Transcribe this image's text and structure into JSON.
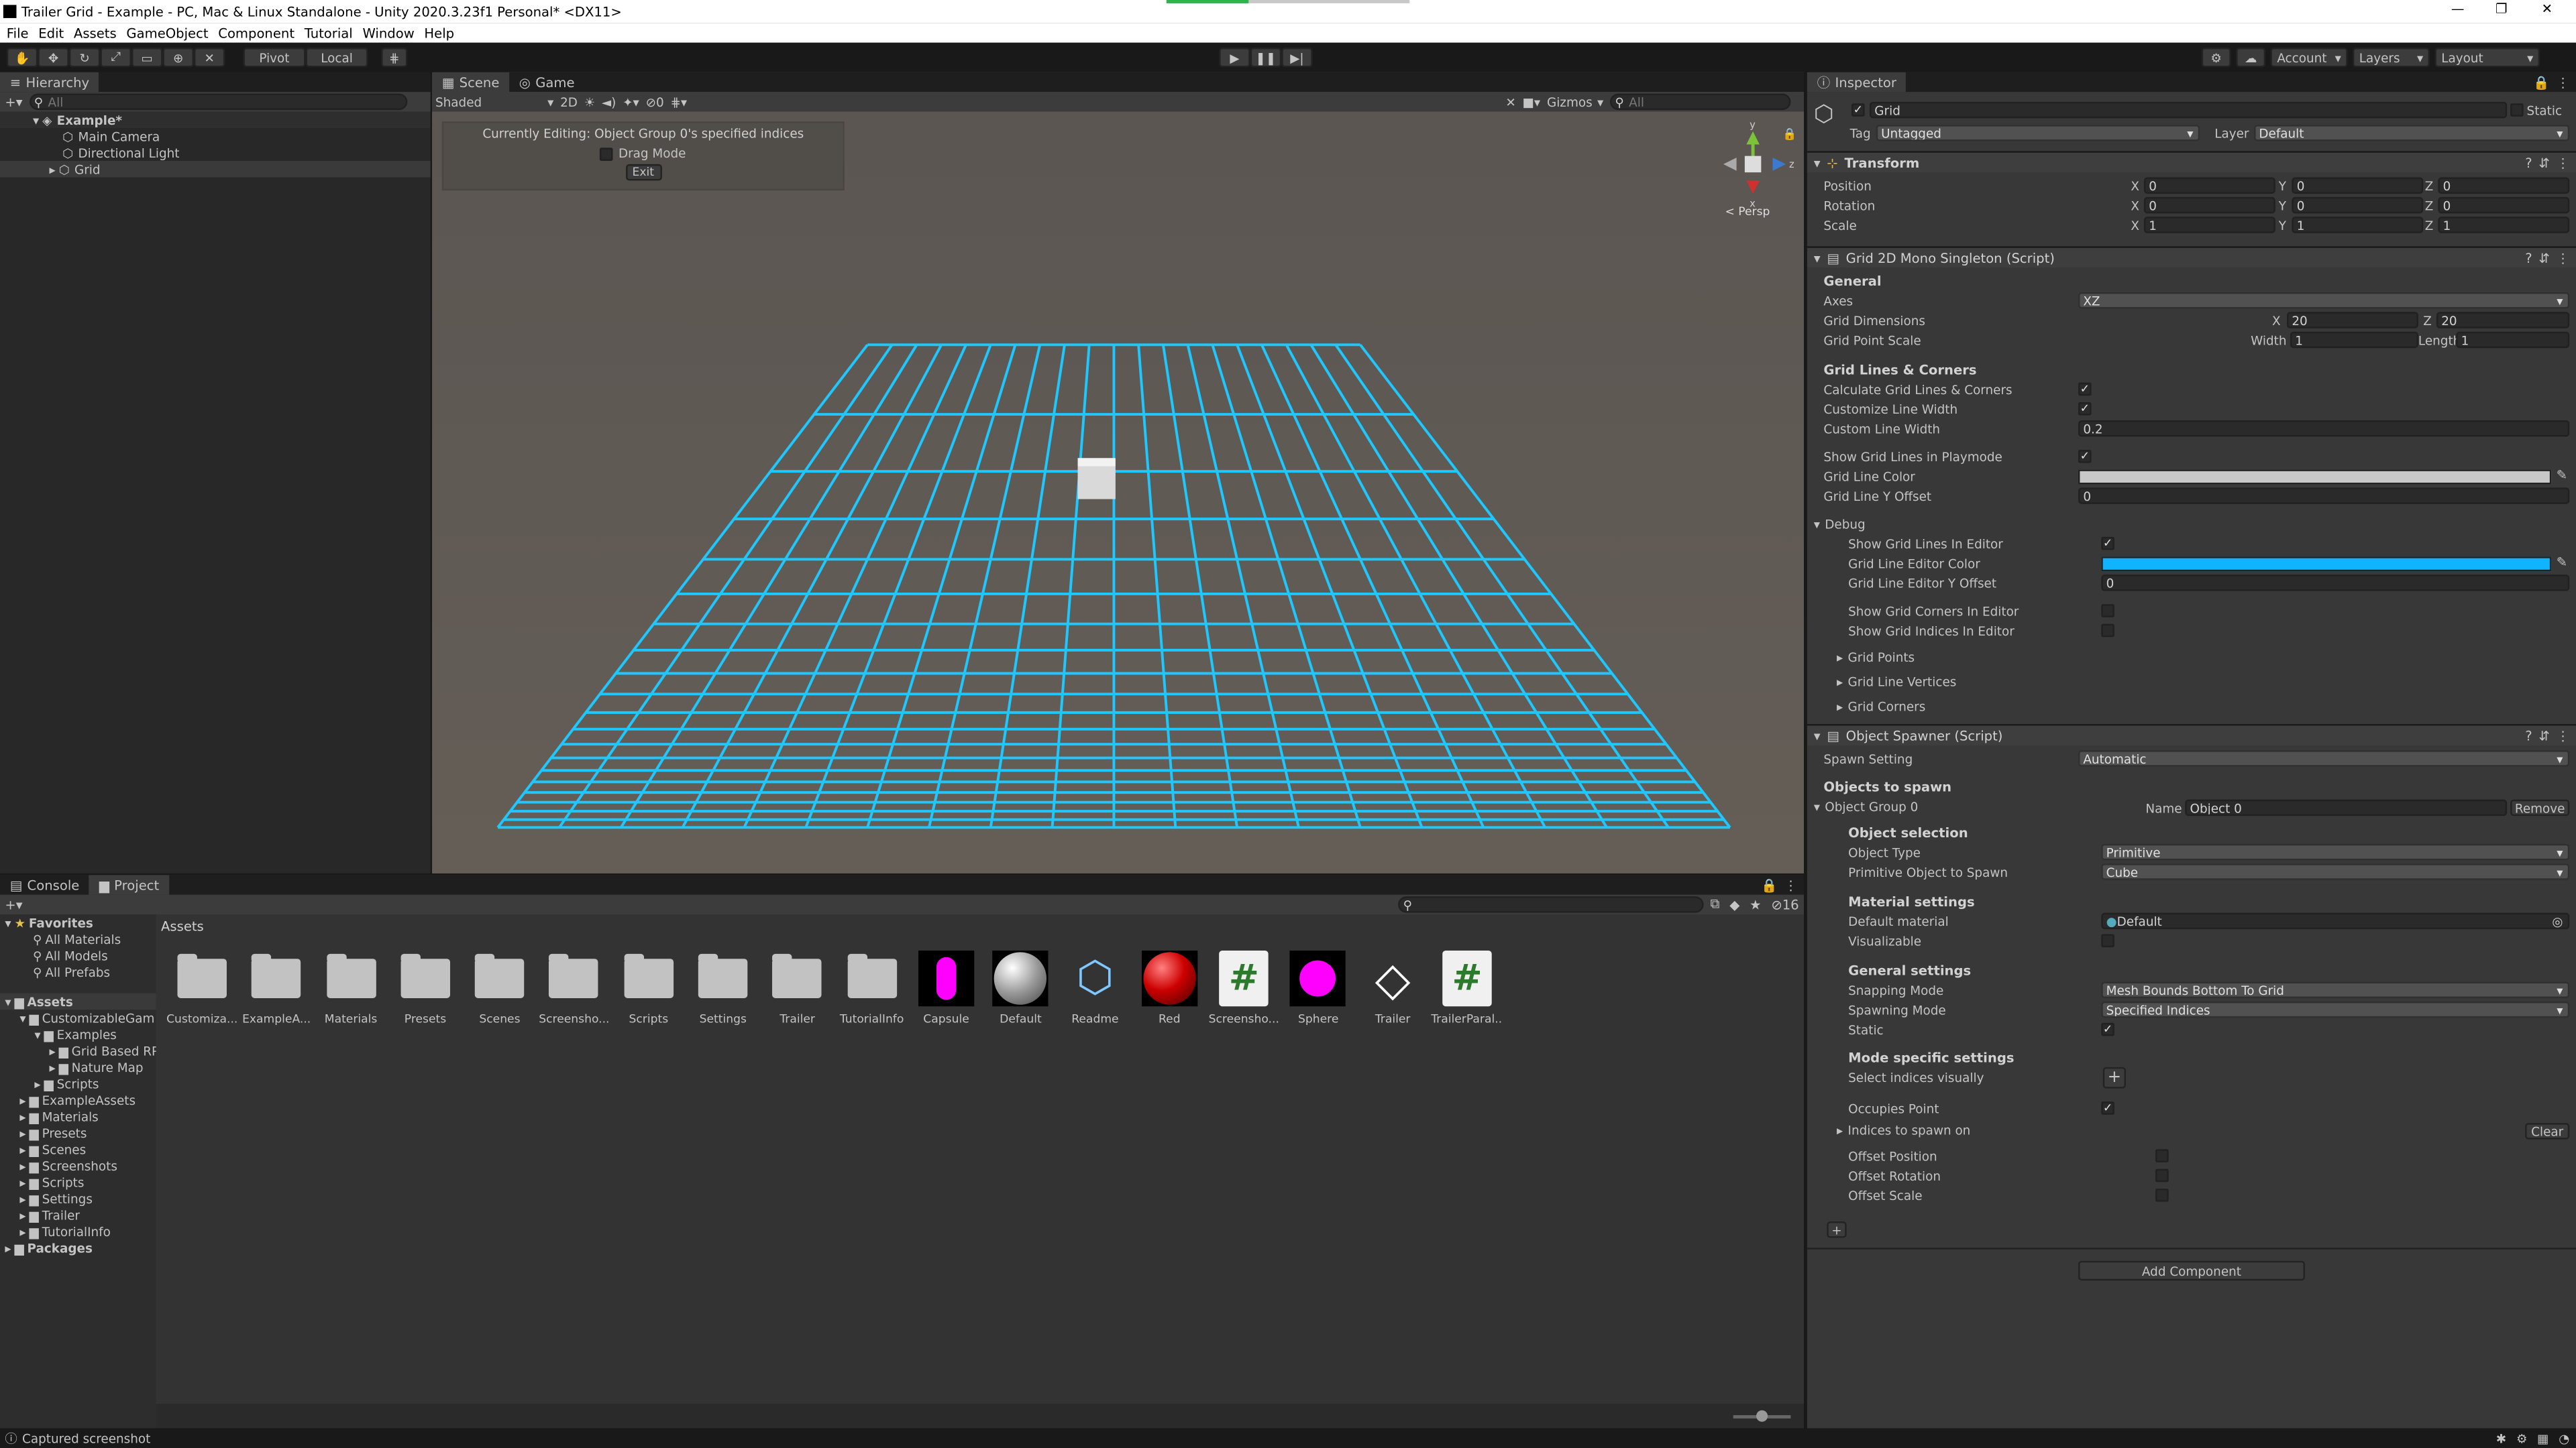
{
  "window": {
    "title": "Trailer Grid - Example - PC, Mac & Linux Standalone - Unity 2020.3.23f1 Personal* <DX11>"
  },
  "menu": [
    "File",
    "Edit",
    "Assets",
    "GameObject",
    "Component",
    "Tutorial",
    "Window",
    "Help"
  ],
  "toolbar": {
    "pivot": "Pivot",
    "local": "Local",
    "account": "Account",
    "layers": "Layers",
    "layout": "Layout"
  },
  "hierarchy": {
    "tab": "Hierarchy",
    "search_placeholder": "All",
    "scene": "Example*",
    "items": [
      "Main Camera",
      "Directional Light",
      "Grid"
    ]
  },
  "scene": {
    "tabs": [
      "Scene",
      "Game"
    ],
    "shading": "Shaded",
    "mode2d": "2D",
    "gizmos": "Gizmos",
    "search_placeholder": "All",
    "persp": "< Persp",
    "overlay": {
      "editing": "Currently Editing: Object Group 0's specified indices",
      "drag": "Drag Mode",
      "exit": "Exit"
    },
    "grid_color": "#1ec8ff"
  },
  "inspector": {
    "tab": "Inspector",
    "name": "Grid",
    "static": "Static",
    "tag_label": "Tag",
    "tag": "Untagged",
    "layer_label": "Layer",
    "layer": "Default",
    "transform": {
      "title": "Transform",
      "rows": [
        {
          "label": "Position",
          "x": "0",
          "y": "0",
          "z": "0"
        },
        {
          "label": "Rotation",
          "x": "0",
          "y": "0",
          "z": "0"
        },
        {
          "label": "Scale",
          "x": "1",
          "y": "1",
          "z": "1"
        }
      ]
    },
    "grid": {
      "title": "Grid 2D Mono Singleton (Script)",
      "general": "General",
      "axes_label": "Axes",
      "axes": "XZ",
      "dims_label": "Grid Dimensions",
      "dim_x": "20",
      "dim_z": "20",
      "scale_label": "Grid Point Scale",
      "width_label": "Width",
      "width": "1",
      "length_label": "Length",
      "length": "1",
      "lines_header": "Grid Lines & Corners",
      "calc": "Calculate Grid Lines & Corners",
      "customize": "Customize Line Width",
      "custom_width_label": "Custom Line Width",
      "custom_width": "0.2",
      "show_play": "Show Grid Lines in Playmode",
      "line_color_label": "Grid Line Color",
      "line_offset_label": "Grid Line Y Offset",
      "line_offset": "0",
      "debug": "Debug",
      "show_editor": "Show Grid Lines In Editor",
      "editor_color_label": "Grid Line Editor Color",
      "editor_offset_label": "Grid Line Editor Y Offset",
      "editor_offset": "0",
      "show_corners": "Show Grid Corners In Editor",
      "show_indices": "Show Grid Indices In Editor",
      "foldouts": [
        "Grid Points",
        "Grid Line Vertices",
        "Grid Corners"
      ],
      "line_color": "#c8c8c8",
      "editor_color": "#0fb4ff"
    },
    "spawner": {
      "title": "Object Spawner (Script)",
      "spawn_setting_label": "Spawn Setting",
      "spawn_setting": "Automatic",
      "objects_header": "Objects to spawn",
      "group": "Object Group 0",
      "name_label": "Name",
      "name": "Object 0",
      "remove": "Remove",
      "selection_header": "Object selection",
      "type_label": "Object Type",
      "type": "Primitive",
      "prim_label": "Primitive Object to Spawn",
      "prim": "Cube",
      "material_header": "Material settings",
      "mat_label": "Default material",
      "mat": "Default",
      "visualizable": "Visualizable",
      "general_header": "General settings",
      "snap_label": "Snapping Mode",
      "snap": "Mesh Bounds Bottom To Grid",
      "spawnmode_label": "Spawning Mode",
      "spawnmode": "Specified Indices",
      "static": "Static",
      "mode_header": "Mode specific settings",
      "select_visual": "Select indices visually",
      "occupies": "Occupies Point",
      "indices": "Indices to spawn on",
      "clear": "Clear",
      "offsets": [
        "Offset Position",
        "Offset Rotation",
        "Offset Scale"
      ]
    },
    "add_component": "Add Component"
  },
  "bottom": {
    "tabs": [
      "Console",
      "Project"
    ],
    "count": "16",
    "breadcrumb": "Assets",
    "favorites": {
      "title": "Favorites",
      "items": [
        "All Materials",
        "All Models",
        "All Prefabs"
      ]
    },
    "tree": {
      "root": "Assets",
      "items": [
        {
          "label": "CustomizableGam",
          "indent": 1,
          "open": true
        },
        {
          "label": "Examples",
          "indent": 2,
          "open": true
        },
        {
          "label": "Grid Based RP",
          "indent": 3,
          "open": false
        },
        {
          "label": "Nature Map",
          "indent": 3,
          "open": false
        },
        {
          "label": "Scripts",
          "indent": 2,
          "open": false
        },
        {
          "label": "ExampleAssets",
          "indent": 1,
          "open": false
        },
        {
          "label": "Materials",
          "indent": 1,
          "open": false
        },
        {
          "label": "Presets",
          "indent": 1,
          "open": false
        },
        {
          "label": "Scenes",
          "indent": 1,
          "open": false
        },
        {
          "label": "Screenshots",
          "indent": 1,
          "open": false
        },
        {
          "label": "Scripts",
          "indent": 1,
          "open": false
        },
        {
          "label": "Settings",
          "indent": 1,
          "open": false
        },
        {
          "label": "Trailer",
          "indent": 1,
          "open": false
        },
        {
          "label": "TutorialInfo",
          "indent": 1,
          "open": false
        }
      ],
      "packages": "Packages"
    },
    "assets": [
      {
        "label": "Customiza...",
        "kind": "folder"
      },
      {
        "label": "ExampleA...",
        "kind": "folder"
      },
      {
        "label": "Materials",
        "kind": "folder"
      },
      {
        "label": "Presets",
        "kind": "folder"
      },
      {
        "label": "Scenes",
        "kind": "folder"
      },
      {
        "label": "Screensho...",
        "kind": "folder"
      },
      {
        "label": "Scripts",
        "kind": "folder"
      },
      {
        "label": "Settings",
        "kind": "folder"
      },
      {
        "label": "Trailer",
        "kind": "folder"
      },
      {
        "label": "TutorialInfo",
        "kind": "folder"
      },
      {
        "label": "Capsule",
        "kind": "capsule"
      },
      {
        "label": "Default",
        "kind": "sphere-grey"
      },
      {
        "label": "Readme",
        "kind": "readme"
      },
      {
        "label": "Red",
        "kind": "sphere-red"
      },
      {
        "label": "Screensho...",
        "kind": "script"
      },
      {
        "label": "Sphere",
        "kind": "sphere-magenta"
      },
      {
        "label": "Trailer",
        "kind": "unity"
      },
      {
        "label": "TrailerParal...",
        "kind": "script"
      }
    ]
  },
  "status": {
    "text": "Captured screenshot"
  }
}
